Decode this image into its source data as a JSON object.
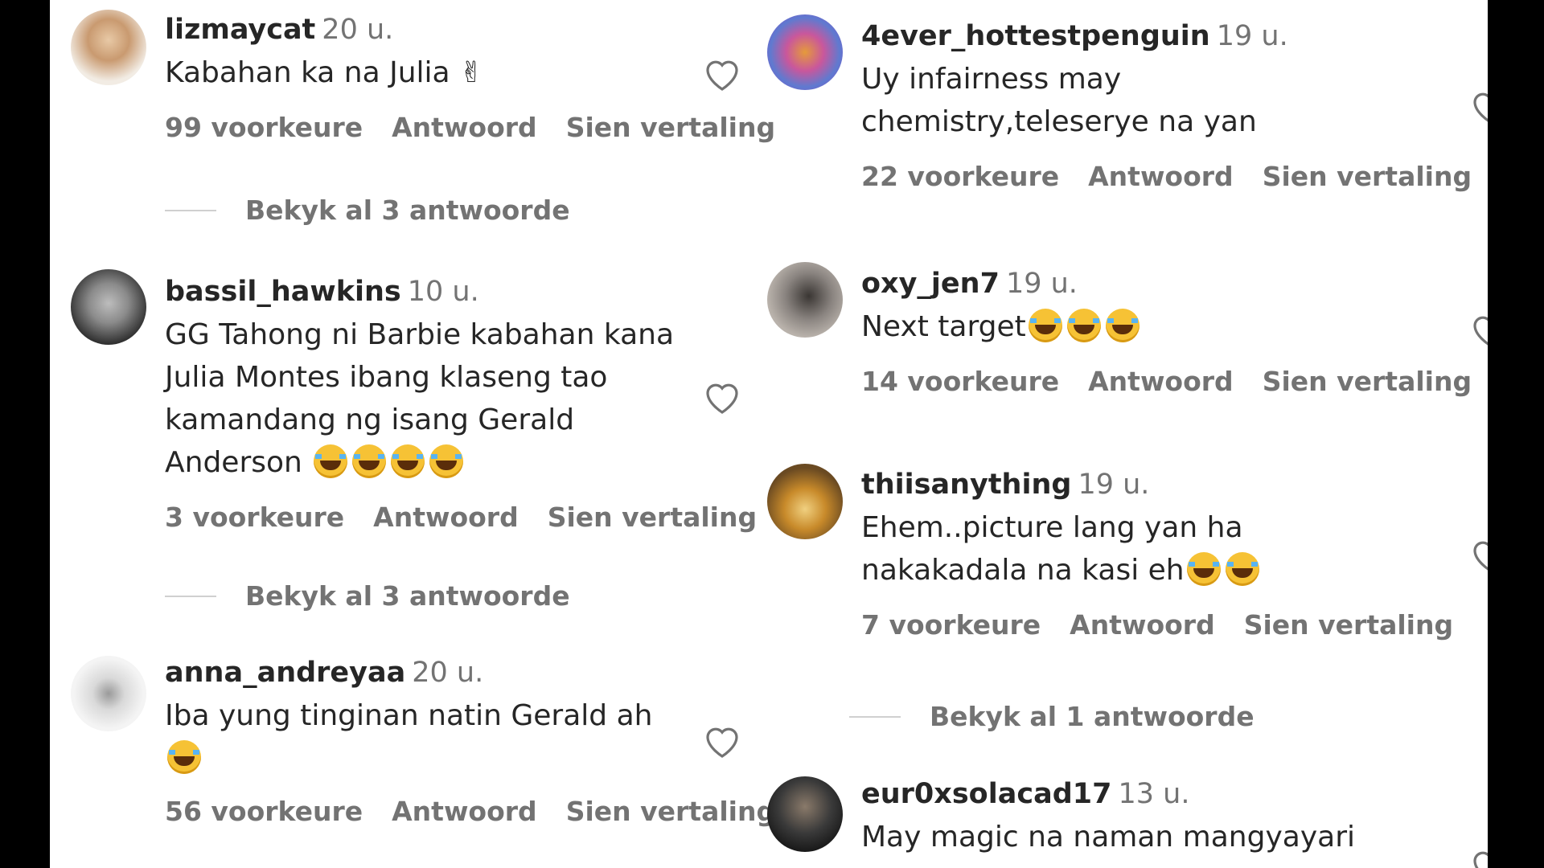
{
  "comments_left": [
    {
      "user": "lizmaycat",
      "time": "20 u.",
      "text": "Kabahan ka na Julia ✌",
      "likes": "99 voorkeure",
      "reply": "Antwoord",
      "translate": "Sien vertaling",
      "view_replies": "Bekyk al 3 antwoorde"
    },
    {
      "user": "bassil_hawkins",
      "time": "10 u.",
      "text": "GG Tahong ni Barbie kabahan kana Julia Montes ibang klaseng tao kamandang ng isang Gerald Anderson",
      "likes": "3 voorkeure",
      "reply": "Antwoord",
      "translate": "Sien vertaling",
      "view_replies": "Bekyk al 3 antwoorde"
    },
    {
      "user": "anna_andreyaa",
      "time": "20 u.",
      "text": "Iba yung tinginan natin Gerald ah",
      "likes": "56 voorkeure",
      "reply": "Antwoord",
      "translate": "Sien vertaling"
    }
  ],
  "comments_right": [
    {
      "user": "4ever_hottestpenguin",
      "time": "19 u.",
      "text": "Uy infairness may chemistry,teleserye na yan",
      "likes": "22 voorkeure",
      "reply": "Antwoord",
      "translate": "Sien vertaling"
    },
    {
      "user": "oxy_jen7",
      "time": "19 u.",
      "text": "Next target",
      "likes": "14 voorkeure",
      "reply": "Antwoord",
      "translate": "Sien vertaling"
    },
    {
      "user": "thiisanything",
      "time": "19 u.",
      "text": "Ehem..picture lang yan ha nakakadala na kasi eh",
      "likes": "7 voorkeure",
      "reply": "Antwoord",
      "translate": "Sien vertaling",
      "view_replies": "Bekyk al 1 antwoorde"
    },
    {
      "user": "eur0xsolacad17",
      "time": "13 u.",
      "text": "May magic na naman mangyayari"
    }
  ],
  "icons": {
    "like": "heart-icon",
    "laugh": "tears-of-joy-emoji"
  },
  "colors": {
    "username": "#262626",
    "secondary": "#737373",
    "background": "#ffffff",
    "frame": "#000000"
  }
}
